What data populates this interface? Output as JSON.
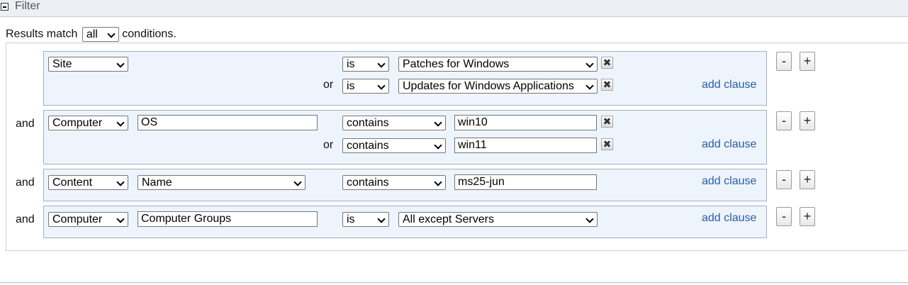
{
  "header": {
    "title": "Filter"
  },
  "match": {
    "prefix": "Results match",
    "value": "all",
    "suffix": "conditions."
  },
  "groups": [
    {
      "conj": "",
      "rows": [
        {
          "field": "Site",
          "op": "is",
          "value": "Patches for Windows",
          "conj": ""
        },
        {
          "op": "is",
          "value": "Updates for Windows Applications",
          "conj": "or"
        }
      ],
      "add_clause": "add clause"
    },
    {
      "conj": "and",
      "rows": [
        {
          "field": "Computer",
          "property": "OS",
          "op": "contains",
          "value": "win10",
          "conj": ""
        },
        {
          "op": "contains",
          "value": "win11",
          "conj": "or"
        }
      ],
      "add_clause": "add clause"
    },
    {
      "conj": "and",
      "rows": [
        {
          "field": "Content",
          "property": "Name",
          "op": "contains",
          "value": "ms25-jun",
          "conj": ""
        }
      ],
      "add_clause": "add clause"
    },
    {
      "conj": "and",
      "rows": [
        {
          "field": "Computer",
          "property": "Computer Groups",
          "op": "is",
          "value": "All except Servers",
          "conj": ""
        }
      ],
      "add_clause": "add clause"
    }
  ],
  "buttons": {
    "minus": "-",
    "plus": "+",
    "remove": "✖"
  }
}
